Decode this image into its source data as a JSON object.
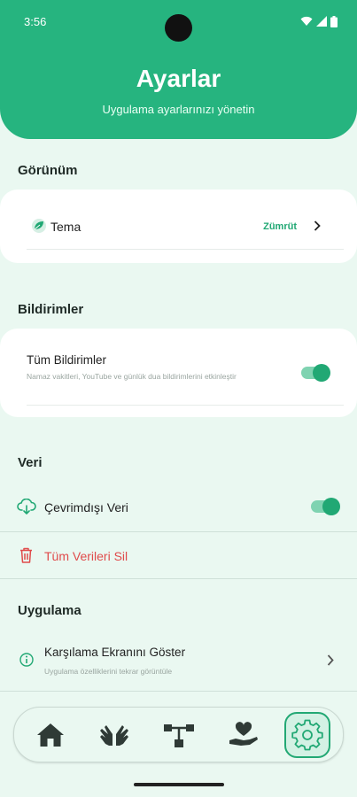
{
  "status": {
    "time": "3:56"
  },
  "header": {
    "title": "Ayarlar",
    "subtitle": "Uygulama ayarlarınızı yönetin"
  },
  "sections": {
    "appearance": {
      "title": "Görünüm",
      "theme_label": "Tema",
      "theme_value": "Zümrüt"
    },
    "notifications": {
      "title": "Bildirimler",
      "all_label": "Tüm Bildirimler",
      "all_desc": "Namaz vakitleri, YouTube ve günlük dua bildirimlerini etkinleştir",
      "all_enabled": true
    },
    "data": {
      "title": "Veri",
      "offline_label": "Çevrimdışı Veri",
      "offline_enabled": true,
      "delete_label": "Tüm Verileri Sil"
    },
    "app": {
      "title": "Uygulama",
      "welcome_label": "Karşılama Ekranını Göster",
      "welcome_desc": "Uygulama özelliklerini tekrar görüntüle"
    }
  },
  "nav": {
    "items": [
      {
        "icon": "home-icon",
        "active": false
      },
      {
        "icon": "praying-hands-icon",
        "active": false
      },
      {
        "icon": "hierarchy-icon",
        "active": false
      },
      {
        "icon": "hand-heart-icon",
        "active": false
      },
      {
        "icon": "gear-icon",
        "active": true
      }
    ]
  },
  "colors": {
    "accent": "#26b47f",
    "danger": "#e04b4b",
    "background": "#eaf8f1"
  }
}
